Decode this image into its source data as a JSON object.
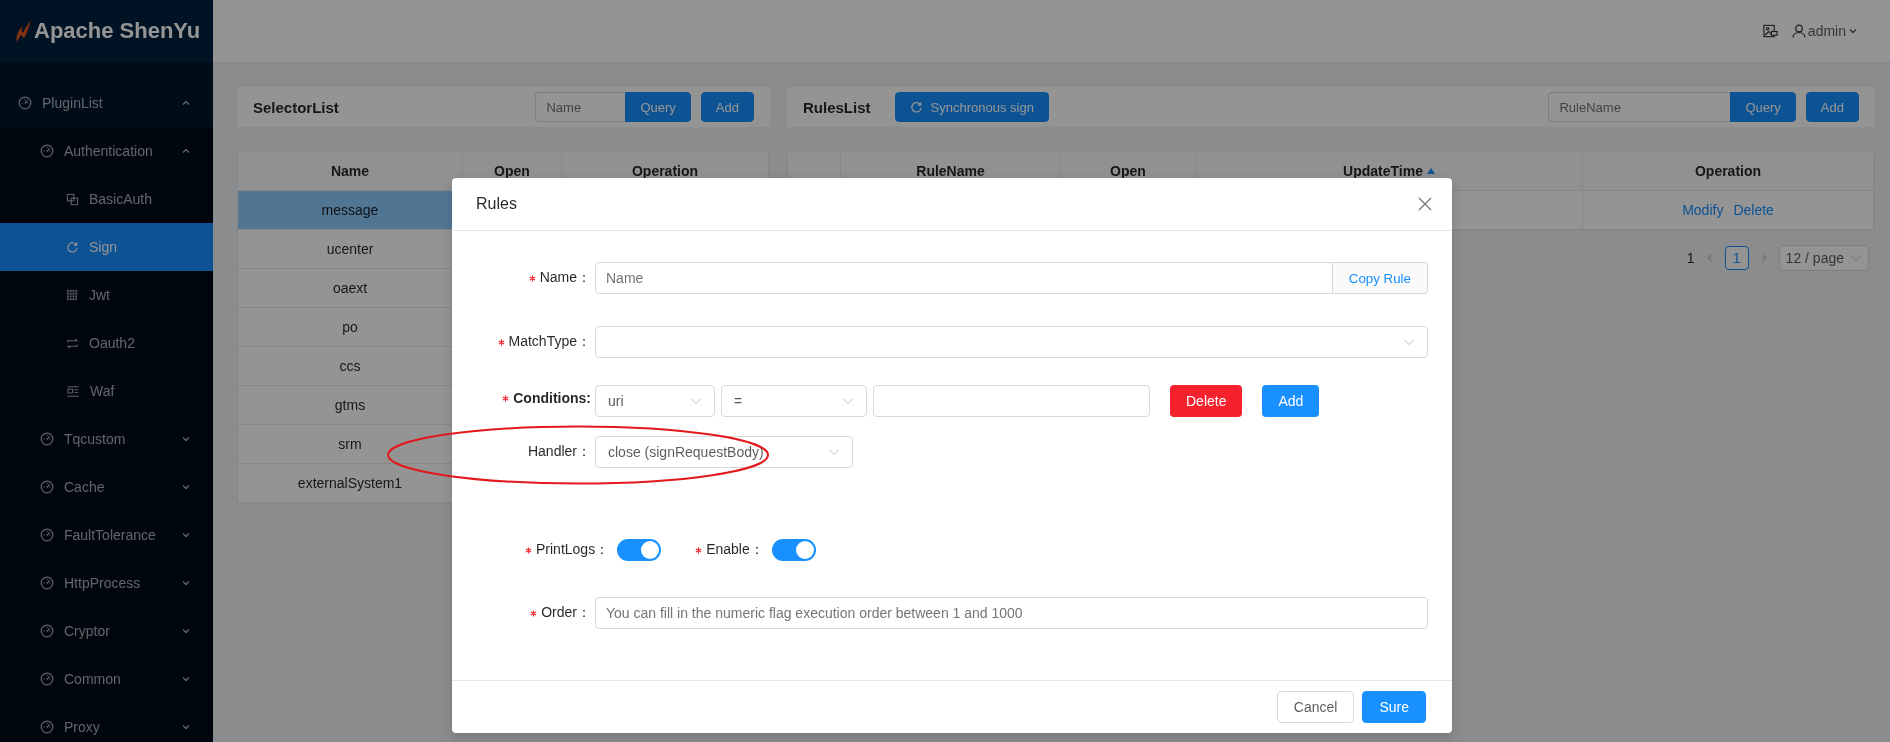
{
  "header": {
    "logo": "Apache ShenYu",
    "user": "admin"
  },
  "sidebar": {
    "items": [
      {
        "label": "PluginList",
        "expanded": true,
        "children": [
          {
            "label": "Authentication",
            "expanded": true,
            "children": [
              {
                "label": "BasicAuth",
                "selected": false
              },
              {
                "label": "Sign",
                "selected": true
              },
              {
                "label": "Jwt",
                "selected": false
              },
              {
                "label": "Oauth2",
                "selected": false
              },
              {
                "label": "Waf",
                "selected": false
              }
            ]
          },
          {
            "label": "Tqcustom",
            "expanded": false
          },
          {
            "label": "Cache",
            "expanded": false
          },
          {
            "label": "FaultTolerance",
            "expanded": false
          },
          {
            "label": "HttpProcess",
            "expanded": false
          },
          {
            "label": "Cryptor",
            "expanded": false
          },
          {
            "label": "Common",
            "expanded": false
          },
          {
            "label": "Proxy",
            "expanded": false
          }
        ]
      }
    ]
  },
  "selector": {
    "title": "SelectorList",
    "search_placeholder": "Name",
    "query": "Query",
    "add": "Add",
    "columns": [
      "Name",
      "Open",
      "Operation"
    ],
    "rows": [
      {
        "name": "message",
        "selected": true
      },
      {
        "name": "ucenter",
        "selected": false
      },
      {
        "name": "oaext",
        "selected": false
      },
      {
        "name": "po",
        "selected": false
      },
      {
        "name": "ccs",
        "selected": false
      },
      {
        "name": "gtms",
        "selected": false
      },
      {
        "name": "srm",
        "selected": false
      },
      {
        "name": "externalSystem1",
        "selected": false
      }
    ]
  },
  "rules": {
    "title": "RulesList",
    "sync": "Synchronous sign",
    "search_placeholder": "RuleName",
    "query": "Query",
    "add": "Add",
    "columns": [
      {
        "label": "RuleName"
      },
      {
        "label": "Open"
      },
      {
        "label": "UpdateTime",
        "sorted_ascending": true
      },
      {
        "label": "Operation"
      }
    ],
    "rows": [
      {
        "actions": [
          "Modify",
          "Delete"
        ]
      }
    ],
    "pagination": {
      "total": "1",
      "pages": [
        {
          "label": "1",
          "selected": true
        }
      ],
      "page_size": "12 / page"
    }
  },
  "modal": {
    "title": "Rules",
    "fields": [
      {
        "kind": "input",
        "label": "Name：",
        "required": true,
        "placeholder": "Name",
        "addon": "Copy Rule"
      },
      {
        "kind": "select",
        "label": "MatchType：",
        "required": true
      },
      {
        "kind": "conditions",
        "label": "Conditions:",
        "required": true,
        "param_type": "uri",
        "operator": "=",
        "delete": "Delete",
        "add": "Add"
      },
      {
        "kind": "select",
        "label": "Handler：",
        "value": "close (signRequestBody)",
        "highlighted": true
      },
      {
        "kind": "switches",
        "items": [
          {
            "label": "PrintLogs：",
            "required": true,
            "on": true
          },
          {
            "label": "Enable：",
            "required": true,
            "on": true
          }
        ]
      },
      {
        "kind": "input",
        "label": "Order：",
        "required": true,
        "placeholder": "You can fill in the numeric flag execution order between 1 and 1000"
      }
    ],
    "buttons": [
      {
        "label": "Cancel",
        "kind": "default"
      },
      {
        "label": "Sure",
        "kind": "primary"
      }
    ]
  }
}
